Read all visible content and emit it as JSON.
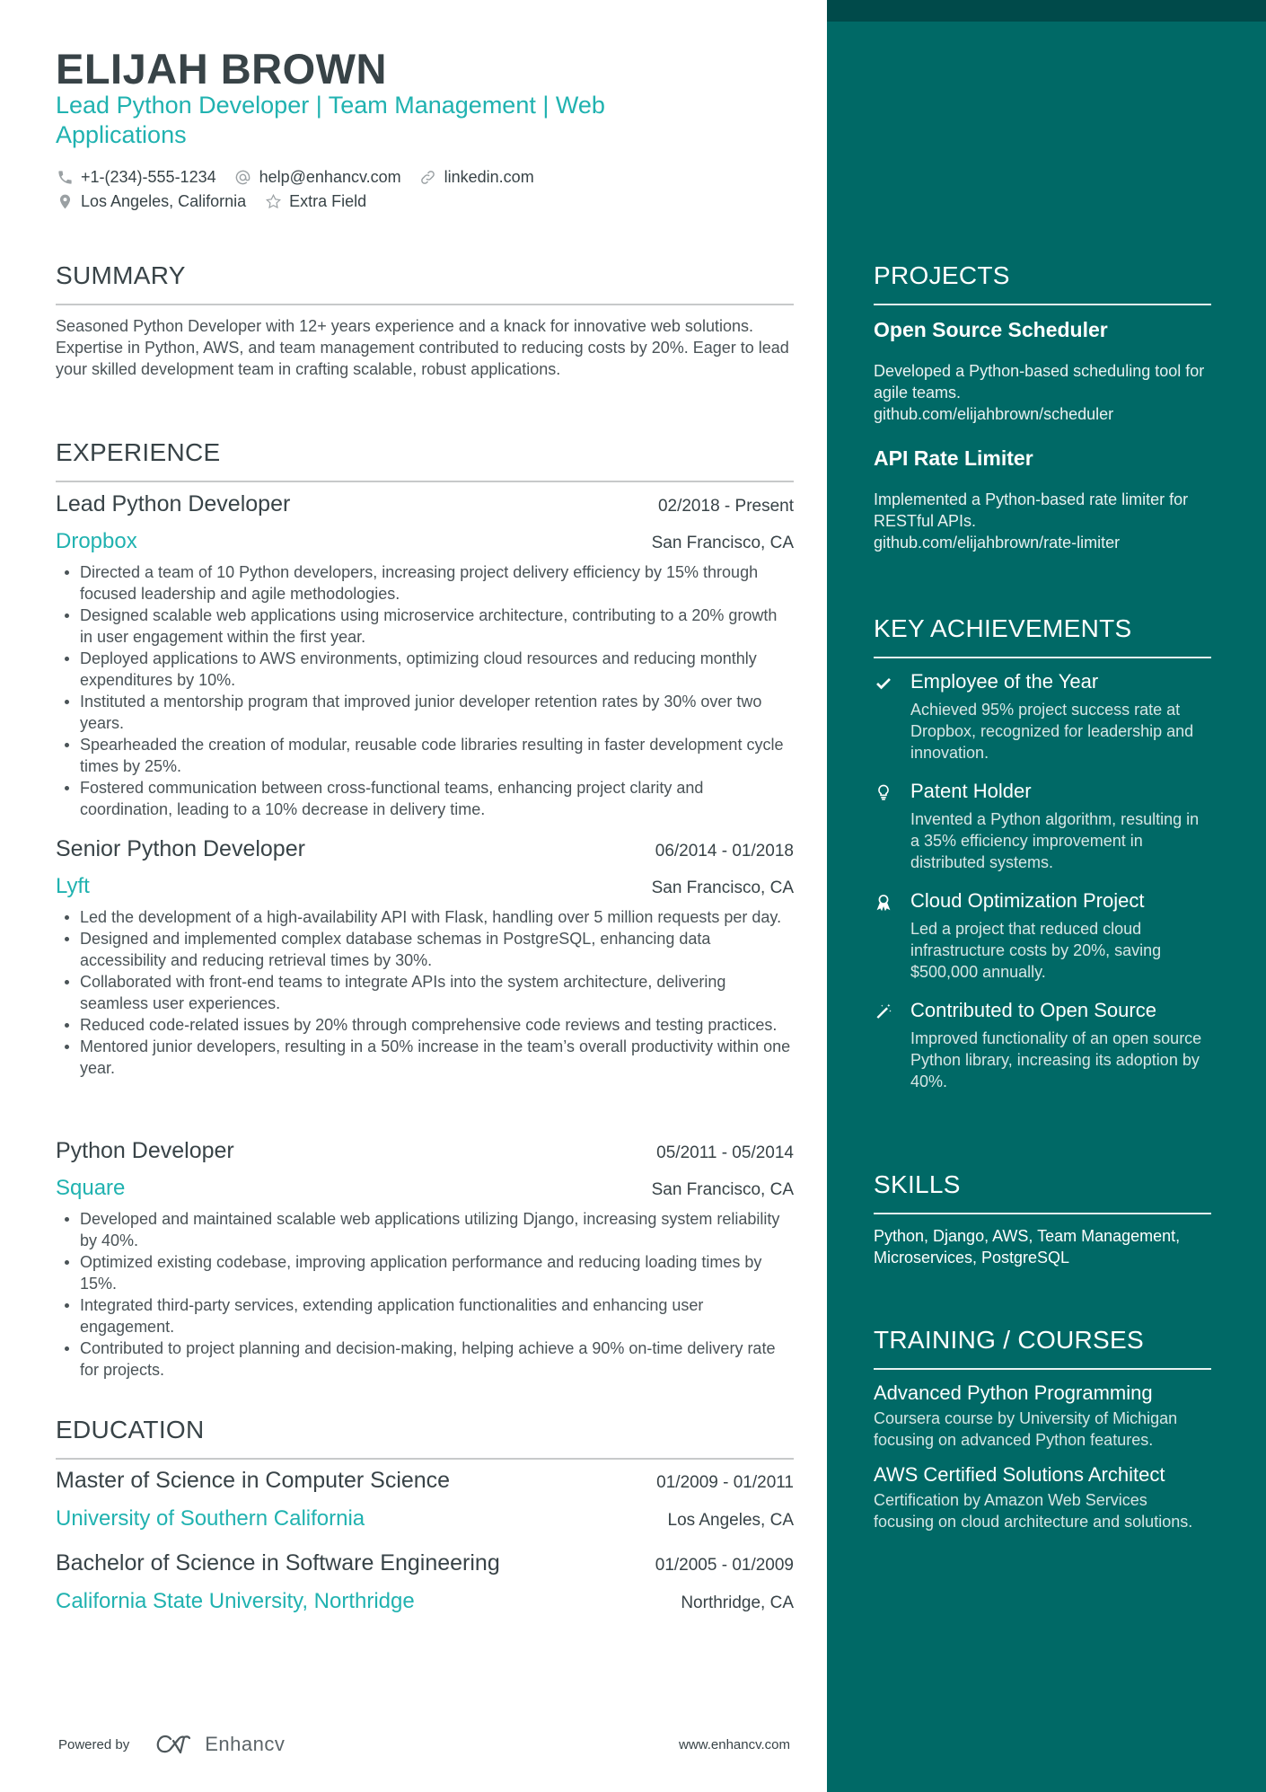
{
  "header": {
    "name": "ELIJAH BROWN",
    "title": "Lead Python Developer | Team Management | Web Applications",
    "contacts": [
      {
        "icon": "phone-icon",
        "text": "+1-(234)-555-1234"
      },
      {
        "icon": "at-icon",
        "text": "help@enhancv.com"
      },
      {
        "icon": "link-icon",
        "text": "linkedin.com"
      },
      {
        "icon": "location-pin-icon",
        "text": "Los Angeles, California"
      },
      {
        "icon": "star-icon",
        "text": "Extra Field"
      }
    ]
  },
  "summary": {
    "heading": "SUMMARY",
    "text": "Seasoned Python Developer with 12+ years experience and a knack for innovative web solutions. Expertise in Python, AWS, and team management contributed to reducing costs by 20%. Eager to lead your skilled development team in crafting scalable, robust applications."
  },
  "experience": {
    "heading": "EXPERIENCE",
    "jobs": [
      {
        "role": "Lead Python Developer",
        "dates": "02/2018 - Present",
        "company": "Dropbox",
        "location": "San Francisco, CA",
        "bullets": [
          "Directed a team of 10 Python developers, increasing project delivery efficiency by 15% through focused leadership and agile methodologies.",
          "Designed scalable web applications using microservice architecture, contributing to a 20% growth in user engagement within the first year.",
          "Deployed applications to AWS environments, optimizing cloud resources and reducing monthly expenditures by 10%.",
          "Instituted a mentorship program that improved junior developer retention rates by 30% over two years.",
          "Spearheaded the creation of modular, reusable code libraries resulting in faster development cycle times by 25%.",
          "Fostered communication between cross-functional teams, enhancing project clarity and coordination, leading to a 10% decrease in delivery time."
        ]
      },
      {
        "role": "Senior Python Developer",
        "dates": "06/2014 - 01/2018",
        "company": "Lyft",
        "location": "San Francisco, CA",
        "bullets": [
          "Led the development of a high-availability API with Flask, handling over 5 million requests per day.",
          "Designed and implemented complex database schemas in PostgreSQL, enhancing data accessibility and reducing retrieval times by 30%.",
          "Collaborated with front-end teams to integrate APIs into the system architecture, delivering seamless user experiences.",
          "Reduced code-related issues by 20% through comprehensive code reviews and testing practices.",
          "Mentored junior developers, resulting in a 50% increase in the team’s overall productivity within one year."
        ]
      },
      {
        "role": "Python Developer",
        "dates": "05/2011 - 05/2014",
        "company": "Square",
        "location": "San Francisco, CA",
        "bullets": [
          "Developed and maintained scalable web applications utilizing Django, increasing system reliability by 40%.",
          "Optimized existing codebase, improving application performance and reducing loading times by 15%.",
          "Integrated third-party services, extending application functionalities and enhancing user engagement.",
          "Contributed to project planning and decision-making, helping achieve a 90% on-time delivery rate for projects."
        ]
      }
    ]
  },
  "education": {
    "heading": "EDUCATION",
    "items": [
      {
        "degree": "Master of Science in Computer Science",
        "dates": "01/2009 - 01/2011",
        "school": "University of Southern California",
        "location": "Los Angeles, CA"
      },
      {
        "degree": "Bachelor of Science in Software Engineering",
        "dates": "01/2005 - 01/2009",
        "school": "California State University, Northridge",
        "location": "Northridge, CA"
      }
    ]
  },
  "footer": {
    "powered_by": "Powered by",
    "brand": "Enhancv",
    "url": "www.enhancv.com"
  },
  "projects": {
    "heading": "PROJECTS",
    "items": [
      {
        "title": "Open Source Scheduler",
        "description": "Developed a Python-based scheduling tool for agile teams.",
        "link": "github.com/elijahbrown/scheduler"
      },
      {
        "title": "API Rate Limiter",
        "description": "Implemented a Python-based rate limiter for RESTful APIs.",
        "link": "github.com/elijahbrown/rate-limiter"
      }
    ]
  },
  "achievements": {
    "heading": "KEY ACHIEVEMENTS",
    "items": [
      {
        "icon": "checkmark-icon",
        "title": "Employee of the Year",
        "description": "Achieved 95% project success rate at Dropbox, recognized for leadership and innovation."
      },
      {
        "icon": "lightbulb-icon",
        "title": "Patent Holder",
        "description": "Invented a Python algorithm, resulting in a 35% efficiency improvement in distributed systems."
      },
      {
        "icon": "award-ribbon-icon",
        "title": "Cloud Optimization Project",
        "description": "Led a project that reduced cloud infrastructure costs by 20%, saving $500,000 annually."
      },
      {
        "icon": "magic-wand-icon",
        "title": "Contributed to Open Source",
        "description": "Improved functionality of an open source Python library, increasing its adoption by 40%."
      }
    ]
  },
  "skills": {
    "heading": "SKILLS",
    "text": "Python, Django, AWS, Team Management, Microservices, PostgreSQL"
  },
  "training": {
    "heading": "TRAINING / COURSES",
    "items": [
      {
        "title": "Advanced Python Programming",
        "description": "Coursera course by University of Michigan focusing on advanced Python features."
      },
      {
        "title": "AWS Certified Solutions Architect",
        "description": "Certification by Amazon Web Services focusing on cloud architecture and solutions."
      }
    ]
  },
  "colors": {
    "accent": "#20b2b0",
    "sidebar": "#006966",
    "sidebar_top": "#004a4a",
    "text": "#384347"
  }
}
